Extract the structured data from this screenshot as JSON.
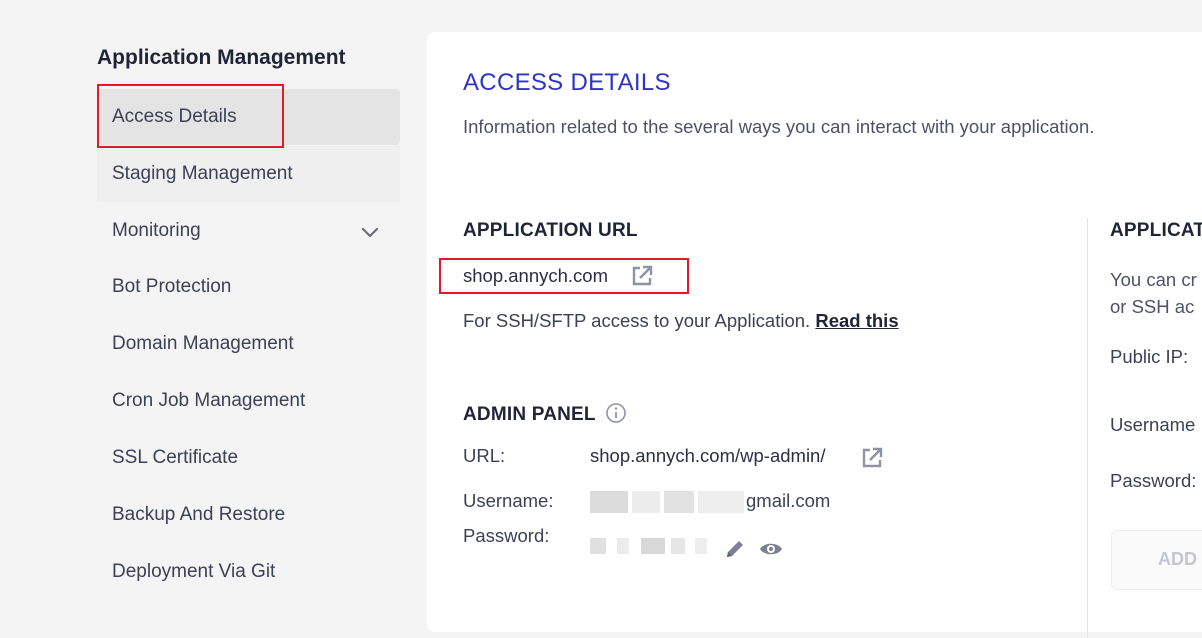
{
  "sidebar": {
    "heading": "Application Management",
    "items": [
      {
        "label": "Access Details"
      },
      {
        "label": "Staging Management"
      },
      {
        "label": "Monitoring"
      },
      {
        "label": "Bot Protection"
      },
      {
        "label": "Domain Management"
      },
      {
        "label": "Cron Job Management"
      },
      {
        "label": "SSL Certificate"
      },
      {
        "label": "Backup And Restore"
      },
      {
        "label": "Deployment Via Git"
      }
    ]
  },
  "main": {
    "title": "ACCESS DETAILS",
    "subtitle": "Information related to the several ways you can interact with your application.",
    "app_url": {
      "heading": "APPLICATION URL",
      "url": "shop.annych.com",
      "ssh_text": "For SSH/SFTP access to your Application.",
      "read_this": "Read this"
    },
    "admin_panel": {
      "heading": "ADMIN PANEL",
      "url_label": "URL:",
      "url_value": "shop.annych.com/wp-admin/",
      "username_label": "Username:",
      "username_value": "gmail.com",
      "password_label": "Password:"
    },
    "right_panel": {
      "heading": "APPLICAT",
      "desc_line1": "You can cr",
      "desc_line2": "or SSH ac",
      "public_ip_label": "Public IP:",
      "username_label": "Username",
      "password_label": "Password:",
      "add_button": "ADD"
    }
  },
  "colors": {
    "accent": "#2e34c4",
    "highlight": "#e2192c",
    "heading": "#1f2437"
  }
}
